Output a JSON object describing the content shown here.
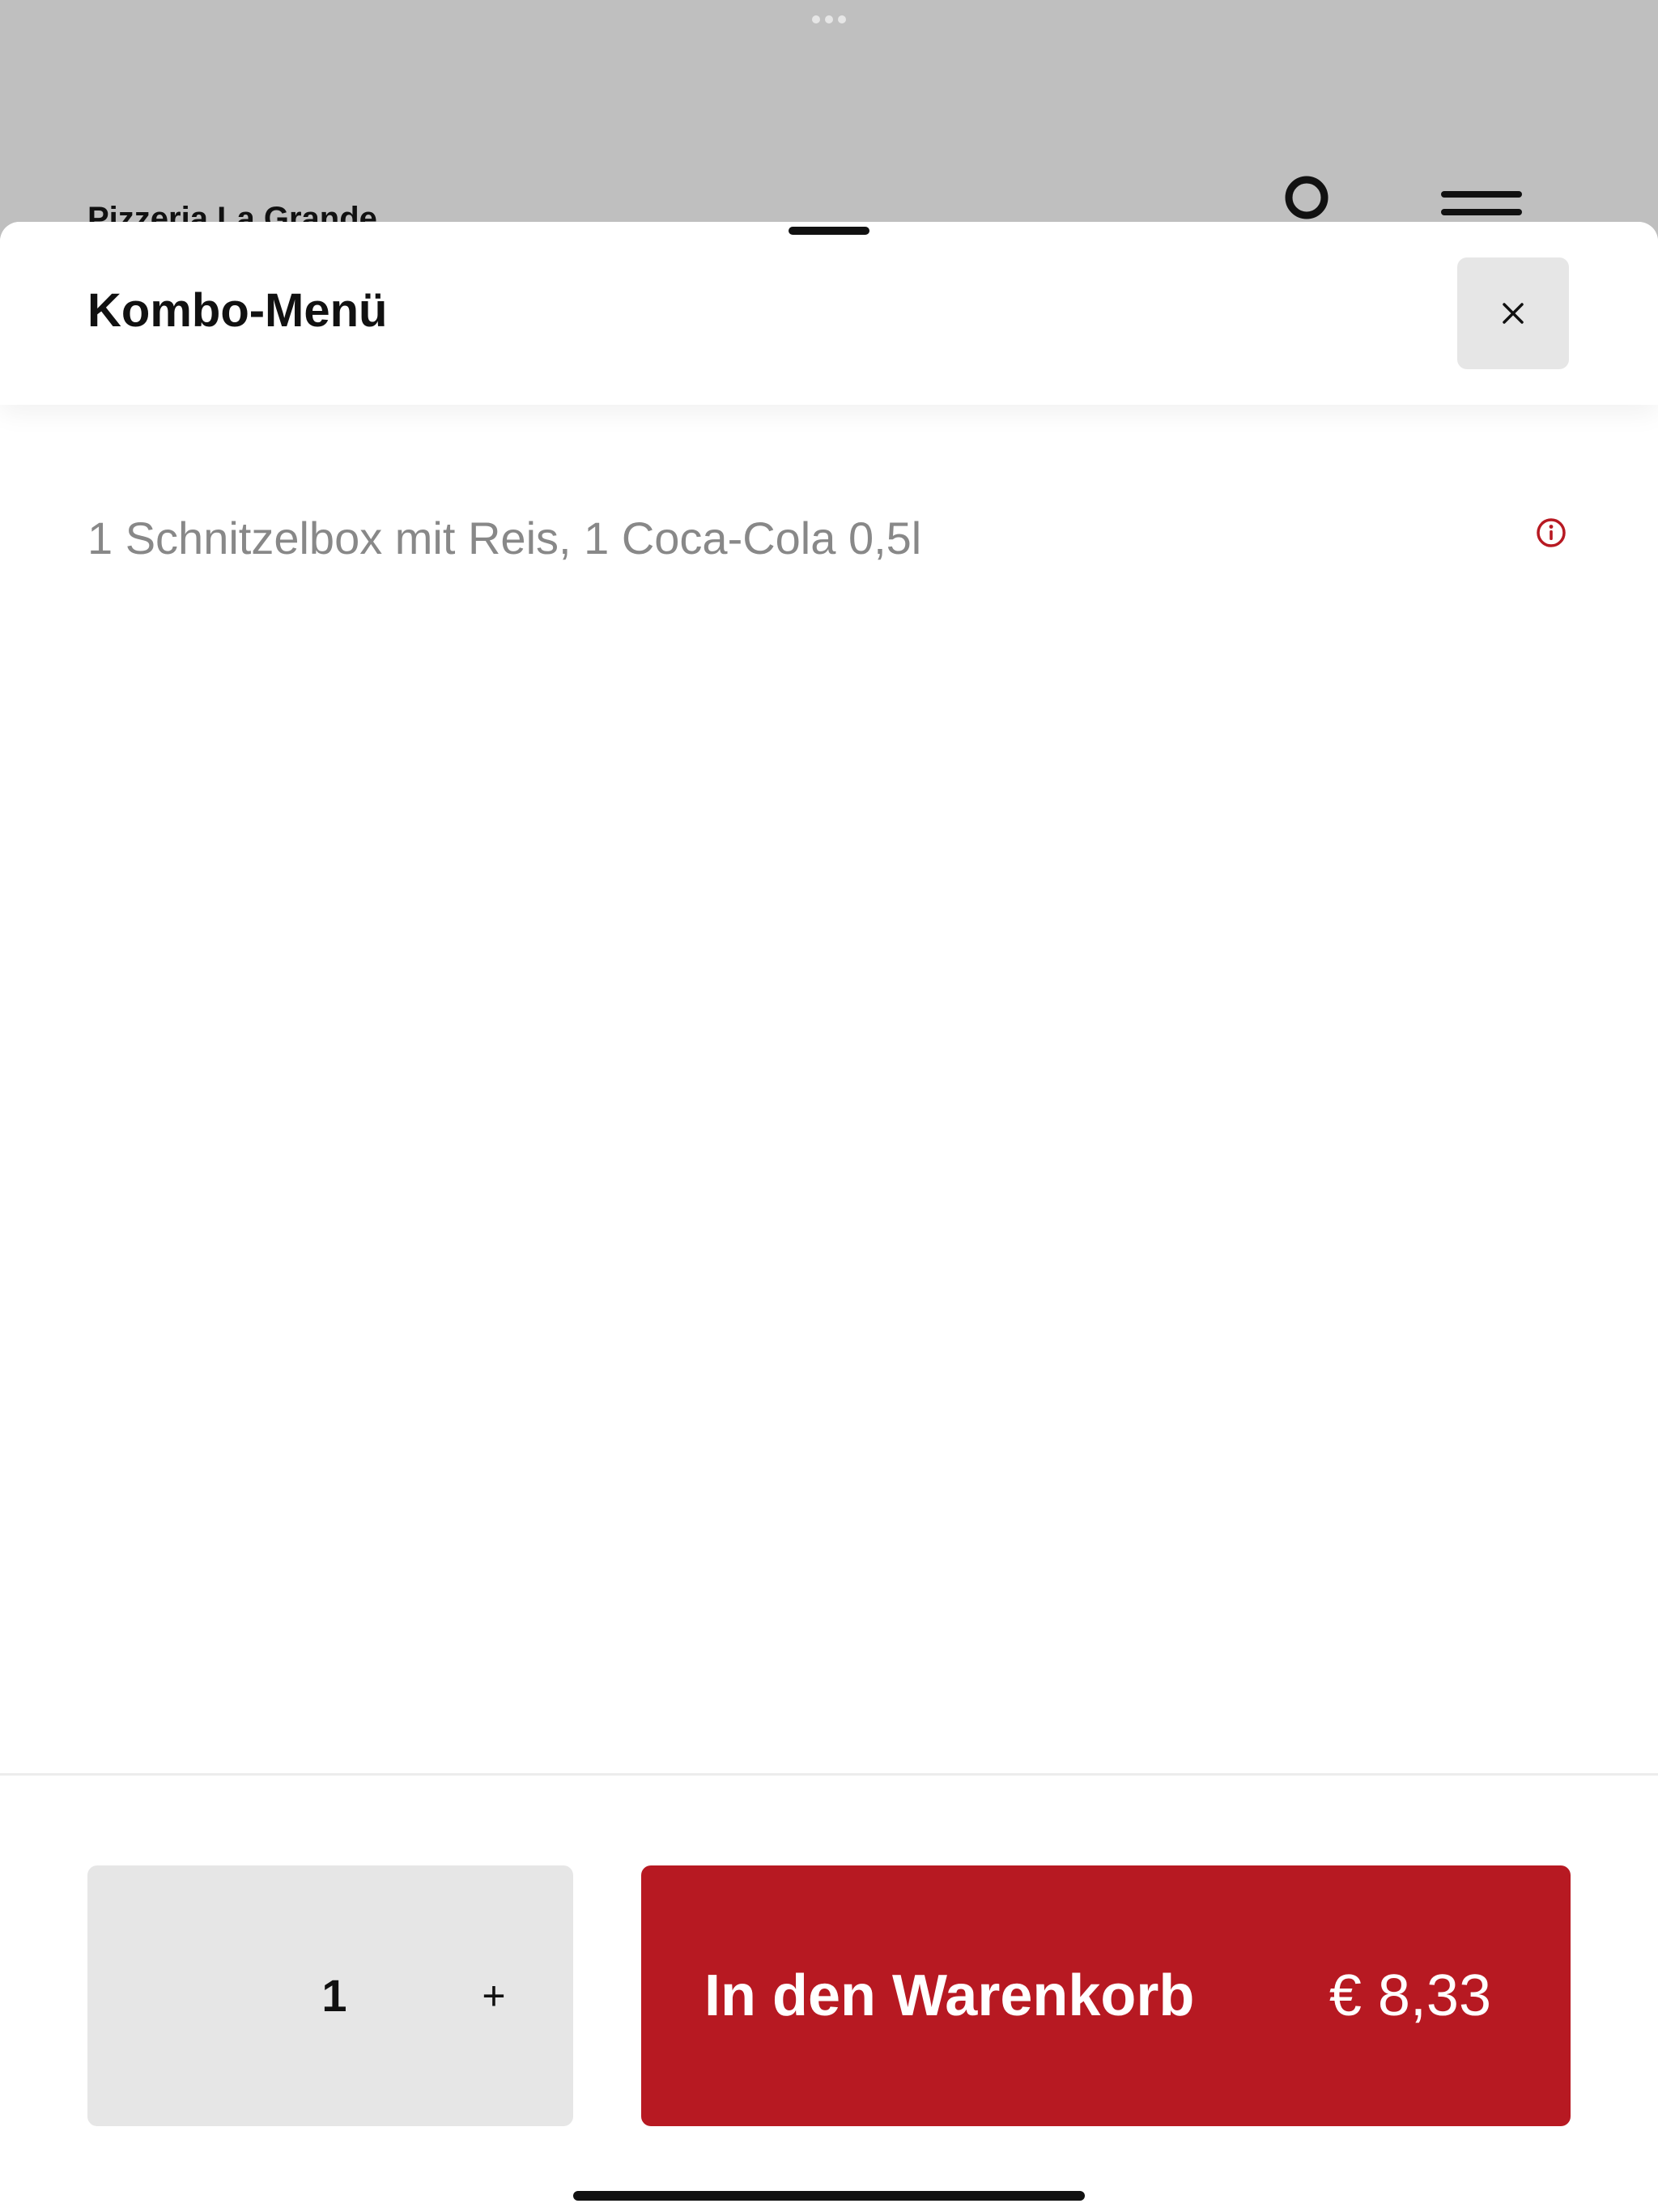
{
  "background_page": {
    "restaurant_name": "Pizzeria La Grande"
  },
  "sheet": {
    "title": "Kombo-Menü",
    "close_icon": "close-icon",
    "description": "1 Schnitzelbox mit Reis, 1 Coca-Cola 0,5l",
    "info_icon": "info-icon"
  },
  "footer": {
    "quantity": "1",
    "plus_label": "+",
    "add_to_cart_label": "In den Warenkorb",
    "price": "€ 8,33"
  },
  "colors": {
    "accent": "#b71922",
    "backdrop": "#bfbfbf",
    "button_neutral": "#e6e6e6",
    "description_text": "#888888"
  }
}
